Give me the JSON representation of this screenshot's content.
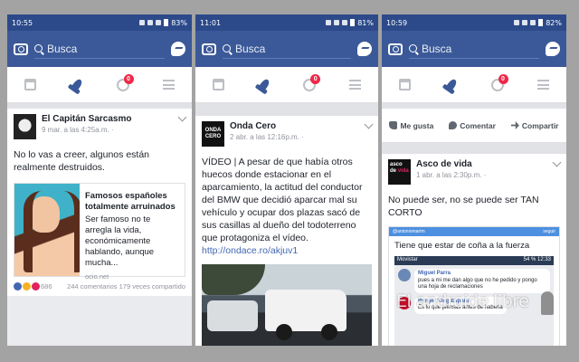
{
  "phones": [
    {
      "status": {
        "time": "10:55",
        "battery": "83%"
      },
      "search_placeholder": "Busca",
      "notif_count": "0",
      "post": {
        "author": "El Capitán Sarcasmo",
        "meta": "9 mar. a las 4:25a.m. · ",
        "text": "No lo vas a creer, algunos están realmente destruidos.",
        "link_title": "Famosos españoles totalmente arruinados",
        "link_desc": "Ser famoso no te arregla la vida, económicamente hablando, aunque mucha...",
        "link_source": "ocio.net",
        "reactions_count": "686",
        "comments": "244 comentarios",
        "shares": "179 veces compartido"
      }
    },
    {
      "status": {
        "time": "11:01",
        "battery": "81%"
      },
      "search_placeholder": "Busca",
      "notif_count": "0",
      "post": {
        "author": "Onda Cero",
        "avatar_text": [
          "ONDA",
          "CERO"
        ],
        "meta": "2 abr. a las 12:16p.m. · ",
        "text": "VÍDEO | A pesar de que había otros huecos donde estacionar en el aparcamiento, la actitud del conductor del BMW que decidió aparcar mal su vehículo y ocupar dos plazas sacó de sus casillas al dueño del todoterreno que protagoniza el vídeo. ",
        "link": "http://ondace.ro/akjuv1"
      }
    },
    {
      "status": {
        "time": "10:59",
        "battery": "82%"
      },
      "search_placeholder": "Busca",
      "notif_count": "0",
      "actions": {
        "like": "Me gusta",
        "comment": "Comentar",
        "share": "Compartir"
      },
      "post": {
        "author": "Asco de vida",
        "avatar_text": [
          "asco",
          "de",
          "vida"
        ],
        "meta": "1 abr. a las 2:30p.m. · ",
        "text": "No puede ser, no se puede ser TAN CORTO",
        "meme_handle": "@antoniomartm",
        "meme_source": "seguir",
        "meme_caption": "Tiene que estar de coña a la fuerza",
        "shot_status_left": "Movistar",
        "shot_status_right": "54 % 12:33",
        "chat1_name": "Miguel Parra",
        "chat1_text": "pues a mi me dan algo que no he pedido y pongo una hoja de reclamaciones",
        "chat2_name": "Burger King España",
        "chat2_text": "Es lo que piensas antes de haberla"
      }
    }
  ],
  "watermark": "El androide libre"
}
